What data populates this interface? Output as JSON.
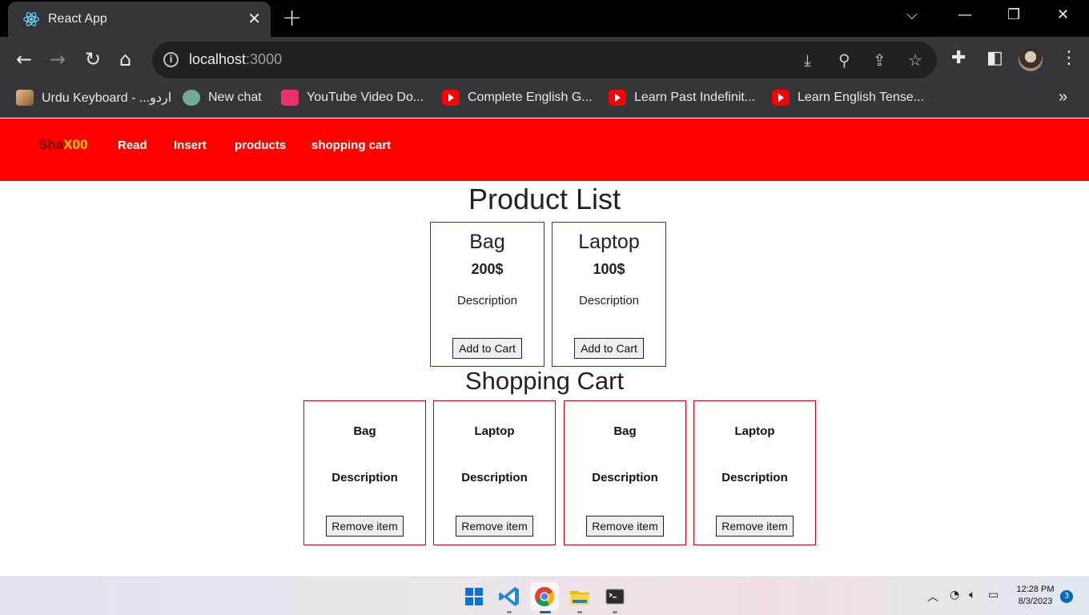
{
  "browser": {
    "tab_title": "React App",
    "url_host": "localhost",
    "url_port": ":3000",
    "bookmarks": [
      {
        "label": "Urdu Keyboard - ...اردو",
        "icon": "urdu-keyboard-icon"
      },
      {
        "label": "New chat",
        "icon": "chatgpt-icon"
      },
      {
        "label": "YouTube Video Do...",
        "icon": "video-downloader-icon"
      },
      {
        "label": "Complete English G...",
        "icon": "youtube-icon"
      },
      {
        "label": "Learn Past Indefinit...",
        "icon": "youtube-icon"
      },
      {
        "label": "Learn English Tense...",
        "icon": "youtube-icon"
      }
    ],
    "bookmarks_overflow": "»"
  },
  "navbar": {
    "brand_part1": "Sha",
    "brand_part2": "X00",
    "links": [
      "Read",
      "Insert",
      "products",
      "shopping cart"
    ],
    "bg_color": "#ff0000"
  },
  "product_list": {
    "heading": "Product List",
    "products": [
      {
        "name": "Bag",
        "price": "200$",
        "description": "Description",
        "button": "Add to Cart"
      },
      {
        "name": "Laptop",
        "price": "100$",
        "description": "Description",
        "button": "Add to Cart"
      }
    ]
  },
  "shopping_cart": {
    "heading": "Shopping Cart",
    "items": [
      {
        "name": "Bag",
        "description": "Description",
        "button": "Remove item"
      },
      {
        "name": "Laptop",
        "description": "Description",
        "button": "Remove item"
      },
      {
        "name": "Bag",
        "description": "Description",
        "button": "Remove item"
      },
      {
        "name": "Laptop",
        "description": "Description",
        "button": "Remove item"
      }
    ]
  },
  "taskbar": {
    "time": "12:28 PM",
    "date": "8/3/2023",
    "notification_count": "3"
  }
}
